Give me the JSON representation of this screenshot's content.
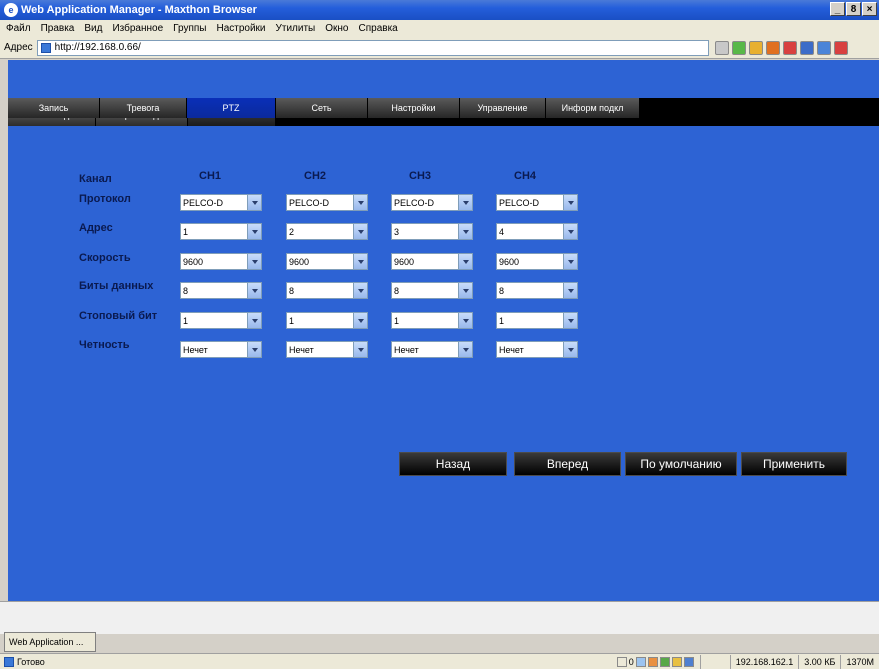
{
  "window": {
    "title": "Web Application Manager - Maxthon Browser",
    "controls": [
      "_",
      "8",
      "×"
    ]
  },
  "menu": [
    "Файл",
    "Правка",
    "Вид",
    "Избранное",
    "Группы",
    "Настройки",
    "Утилиты",
    "Окно",
    "Справка"
  ],
  "address": {
    "label": "Адрес",
    "url": "http://192.168.0.66/"
  },
  "top_tabs": [
    {
      "label": "Живое видео",
      "active": false
    },
    {
      "label": "Воспроизведение",
      "active": false
    },
    {
      "label": "Установки",
      "active": true
    }
  ],
  "sub_tabs": [
    {
      "label": "Запись",
      "active": false
    },
    {
      "label": "Тревога",
      "active": false
    },
    {
      "label": "PTZ",
      "active": true
    },
    {
      "label": "Сеть",
      "active": false
    },
    {
      "label": "Настройки",
      "active": false
    },
    {
      "label": "Управление",
      "active": false
    },
    {
      "label": "Информ подкл",
      "active": false
    }
  ],
  "ptz": {
    "channel_label": "Канал",
    "channels": [
      "CH1",
      "CH2",
      "CH3",
      "CH4"
    ],
    "rows": [
      {
        "label": "Протокол",
        "values": [
          "PELCO-D",
          "PELCO-D",
          "PELCO-D",
          "PELCO-D"
        ]
      },
      {
        "label": "Адрес",
        "values": [
          "1",
          "2",
          "3",
          "4"
        ]
      },
      {
        "label": "Скорость",
        "values": [
          "9600",
          "9600",
          "9600",
          "9600"
        ]
      },
      {
        "label": "Биты данных",
        "values": [
          "8",
          "8",
          "8",
          "8"
        ]
      },
      {
        "label": "Стоповый бит",
        "values": [
          "1",
          "1",
          "1",
          "1"
        ]
      },
      {
        "label": "Четность",
        "values": [
          "Нечет",
          "Нечет",
          "Нечет",
          "Нечет"
        ]
      }
    ]
  },
  "actions": {
    "back": "Назад",
    "forward": "Вперед",
    "default": "По умолчанию",
    "apply": "Применить"
  },
  "taskbar": {
    "tab": "Web Application ..."
  },
  "status": {
    "text": "Готово",
    "count": "0",
    "ip": "192.168.162.1",
    "size": "3.00 КБ",
    "memory": "1370M"
  },
  "colors": {
    "content_bg": "#2d63d4",
    "tab_active": "#0b2a9c"
  }
}
